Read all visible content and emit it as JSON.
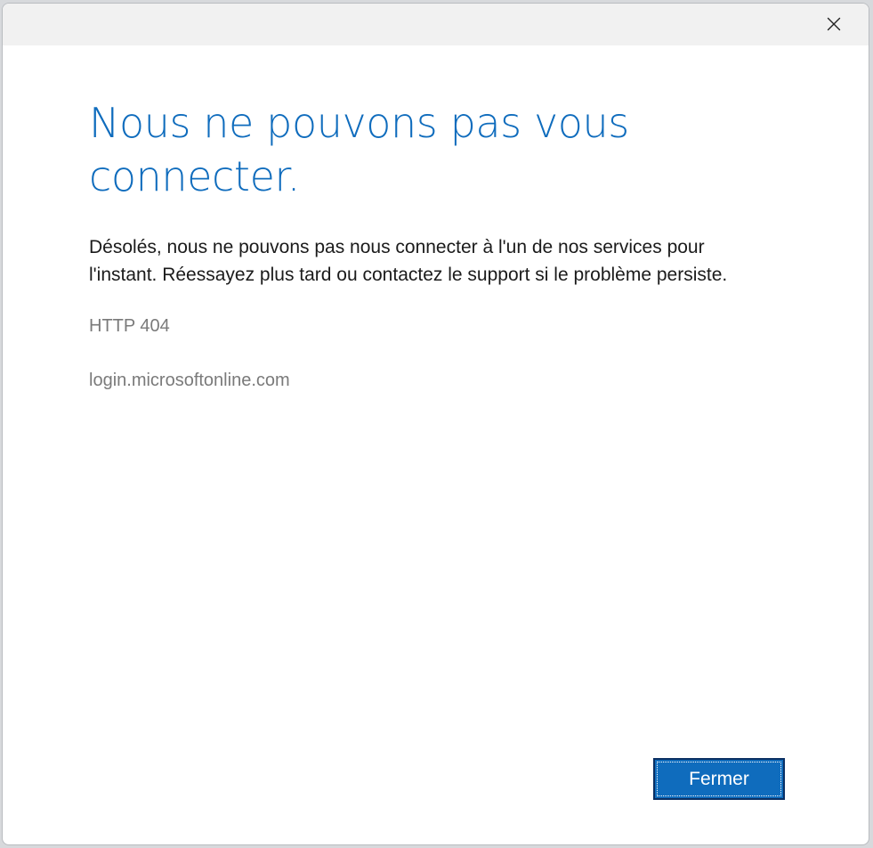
{
  "dialog": {
    "heading": "Nous ne pouvons pas vous connecter.",
    "message": "Désolés, nous ne pouvons pas nous connecter à l'un de nos services pour l'instant. Réessayez plus tard ou contactez le support si le problème persiste.",
    "http_code": "HTTP 404",
    "host": "login.microsoftonline.com",
    "close_button_label": "Fermer",
    "close_icon": "close-icon"
  },
  "colors": {
    "accent": "#0f6cbd",
    "title_bar": "#f1f1f1",
    "secondary_text": "#7a7a7a",
    "body_text": "#1b1b1b",
    "button_border": "#0a2f63"
  }
}
